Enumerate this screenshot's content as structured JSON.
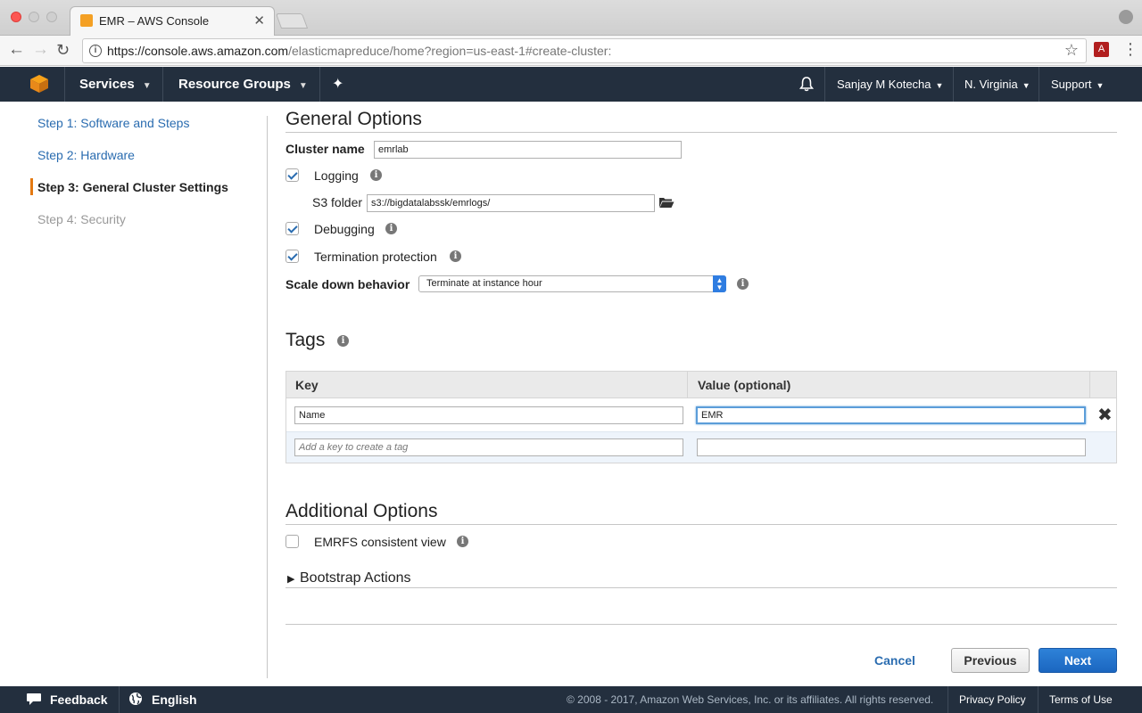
{
  "browser": {
    "tab_title": "EMR – AWS Console",
    "tab_close": "✕",
    "url_host": "https://console.aws.amazon.com",
    "url_path": "/elasticmapreduce/home?region=us-east-1#create-cluster:"
  },
  "aws_nav": {
    "services": "Services",
    "resource_groups": "Resource Groups",
    "user": "Sanjay M Kotecha",
    "region": "N. Virginia",
    "support": "Support"
  },
  "steps": [
    {
      "label": "Step 1: Software and Steps"
    },
    {
      "label": "Step 2: Hardware"
    },
    {
      "label": "Step 3: General Cluster Settings"
    },
    {
      "label": "Step 4: Security"
    }
  ],
  "general": {
    "title": "General Options",
    "cluster_name_label": "Cluster name",
    "cluster_name_value": "emrlab",
    "logging_label": "Logging",
    "logging_checked": true,
    "s3_folder_label": "S3 folder",
    "s3_folder_value": "s3://bigdatalabssk/emrlogs/",
    "debugging_label": "Debugging",
    "debugging_checked": true,
    "termination_label": "Termination protection",
    "termination_checked": true,
    "scale_down_label": "Scale down behavior",
    "scale_down_value": "Terminate at instance hour"
  },
  "tags": {
    "title": "Tags",
    "col_key": "Key",
    "col_value": "Value (optional)",
    "rows": [
      {
        "key": "Name",
        "value": "EMR"
      }
    ],
    "new_key_placeholder": "Add a key to create a tag",
    "new_value": ""
  },
  "additional": {
    "title": "Additional Options",
    "emrfs_label": "EMRFS consistent view",
    "emrfs_checked": false,
    "bootstrap_label": "Bootstrap Actions"
  },
  "buttons": {
    "cancel": "Cancel",
    "previous": "Previous",
    "next": "Next"
  },
  "footer": {
    "feedback": "Feedback",
    "language": "English",
    "copyright": "© 2008 - 2017, Amazon Web Services, Inc. or its affiliates. All rights reserved.",
    "privacy": "Privacy Policy",
    "terms": "Terms of Use"
  },
  "colors": {
    "aws_nav_bg": "#232f3e",
    "link_blue": "#2a6cb0",
    "step_marker": "#e47911",
    "primary_button": "#1b66c0"
  }
}
